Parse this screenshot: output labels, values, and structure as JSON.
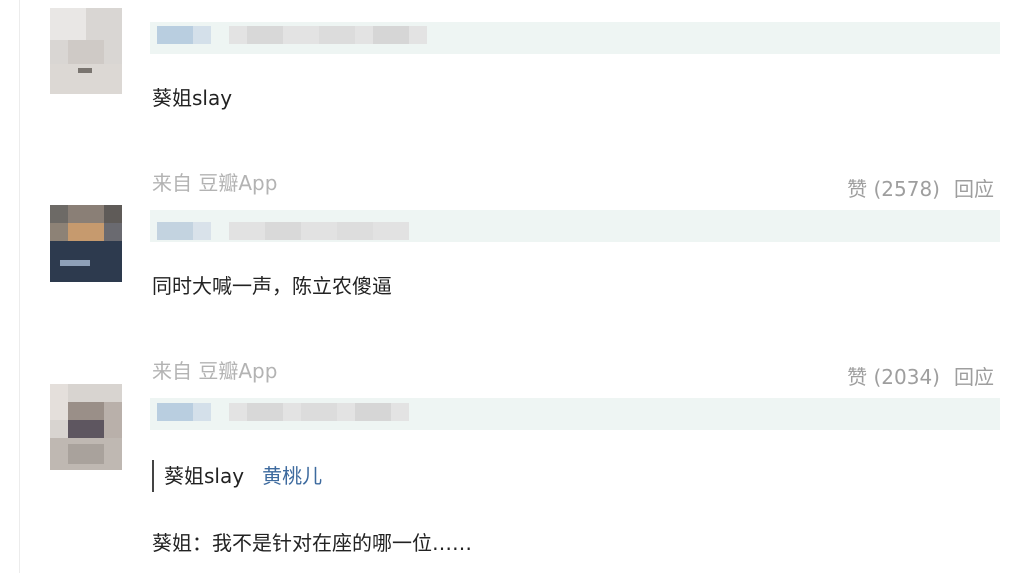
{
  "comments": [
    {
      "text": "葵姐slay",
      "source": "来自 豆瓣App",
      "like_label": "赞 (2578)",
      "reply_label": "回应"
    },
    {
      "text": "同时大喊一声，陈立农傻逼",
      "source": "来自 豆瓣App",
      "like_label": "赞 (2034)",
      "reply_label": "回应"
    },
    {
      "quote_text": "葵姐slay",
      "quote_author": "黄桃儿",
      "text": "葵姐：我不是针对在座的哪一位……"
    }
  ],
  "colors": {
    "header_band": "#eef5f3",
    "meta_gray": "#9e9e9e",
    "quote_author": "#3d6a9e"
  }
}
